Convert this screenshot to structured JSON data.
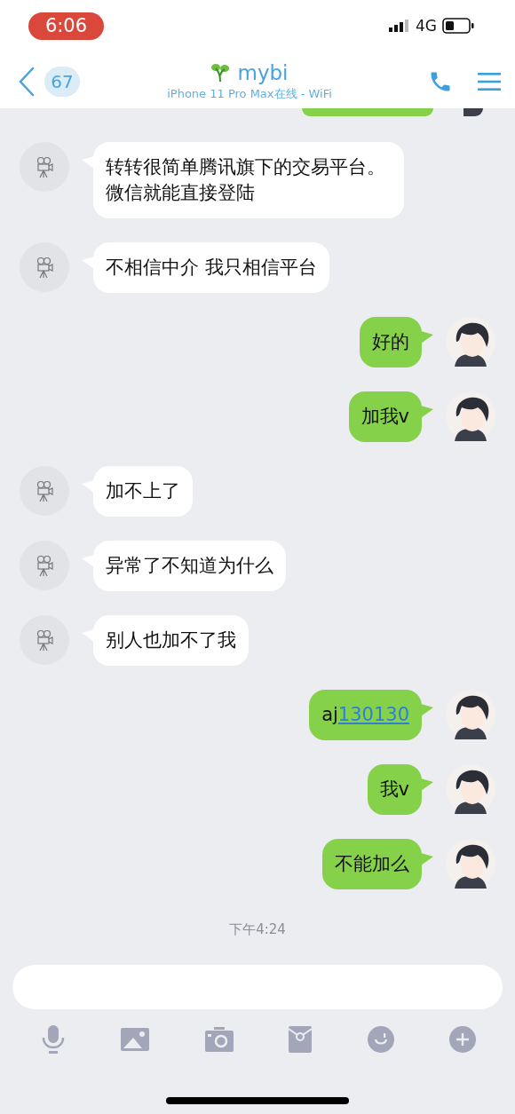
{
  "status_bar": {
    "time": "6:06",
    "network": "4G"
  },
  "header": {
    "unread_count": "67",
    "title": "mybi",
    "subtitle": "iPhone 11 Pro Max在线 - WiFi"
  },
  "messages": [
    {
      "kind": "received",
      "text": "转转很简单腾讯旗下的交易平台。微信就能直接登陆"
    },
    {
      "kind": "received",
      "text": "不相信中介 我只相信平台"
    },
    {
      "kind": "sent",
      "text": "好的"
    },
    {
      "kind": "sent",
      "text": "加我v"
    },
    {
      "kind": "received",
      "text": "加不上了"
    },
    {
      "kind": "received",
      "text": "异常了不知道为什么"
    },
    {
      "kind": "received",
      "text": "别人也加不了我"
    },
    {
      "kind": "sent",
      "text": "aj",
      "link": "130130"
    },
    {
      "kind": "sent",
      "text": "我v"
    },
    {
      "kind": "sent",
      "text": "不能加么"
    }
  ],
  "timestamp": "下午4:24"
}
